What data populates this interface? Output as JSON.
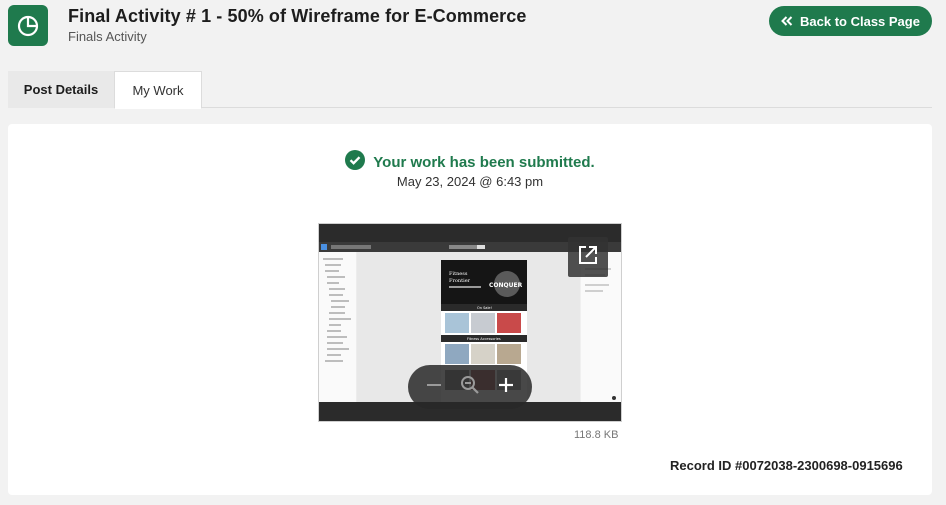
{
  "header": {
    "title": "Final Activity # 1 - 50% of Wireframe for E-Commerce",
    "subtitle": "Finals Activity",
    "app_icon": "pie-chart-icon",
    "back_button_label": "Back to Class Page",
    "back_button_icon": "double-chevron-left-icon",
    "accent_color": "#1f7a4d"
  },
  "tabs": [
    {
      "label": "Post Details",
      "active": false
    },
    {
      "label": "My Work",
      "active": true
    }
  ],
  "submission": {
    "status_icon": "check-circle-icon",
    "status_text": "Your work has been submitted.",
    "date": "May 23, 2024 @ 6:43 pm",
    "attachment": {
      "size": "118.8 KB",
      "open_icon": "external-link-icon",
      "zoom_out_icon": "minus-icon",
      "zoom_reset_icon": "zoom-out-icon",
      "zoom_in_icon": "plus-icon",
      "preview_text": {
        "brand_line1": "Fitness",
        "brand_line2": "Frontier",
        "hero_word": "CONQUER",
        "section1": "On Sale!",
        "section2": "Fitness Accessories"
      }
    },
    "record_id": "Record ID #0072038-2300698-0915696"
  }
}
